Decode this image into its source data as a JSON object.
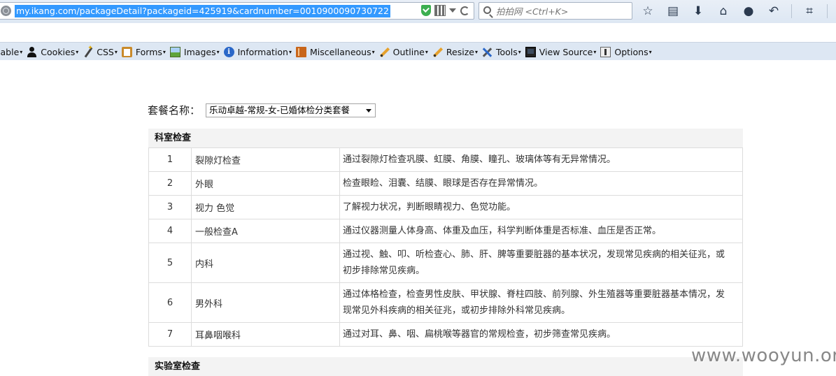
{
  "browser": {
    "url": "my.ikang.com/packageDetail?packageid=425919&cardnumber=0010900090730722",
    "search_placeholder": "拍拍网 <Ctrl+K>"
  },
  "devtoolbar": {
    "items": [
      {
        "label": "sable",
        "icon": "none"
      },
      {
        "label": "Cookies",
        "icon": "person-icon"
      },
      {
        "label": "CSS",
        "icon": "wand-icon"
      },
      {
        "label": "Forms",
        "icon": "clipboard-icon"
      },
      {
        "label": "Images",
        "icon": "image-icon"
      },
      {
        "label": "Information",
        "icon": "info-icon"
      },
      {
        "label": "Miscellaneous",
        "icon": "book-icon"
      },
      {
        "label": "Outline",
        "icon": "pencil-icon"
      },
      {
        "label": "Resize",
        "icon": "pencil-icon"
      },
      {
        "label": "Tools",
        "icon": "tools-icon"
      },
      {
        "label": "View Source",
        "icon": "screen-icon"
      },
      {
        "label": "Options",
        "icon": "options-icon"
      }
    ]
  },
  "page": {
    "package_label": "套餐名称：",
    "package_selected": "乐动卓越-常规-女-已婚体检分类套餐",
    "sections": [
      {
        "title": "科室检查",
        "rows": [
          {
            "num": "1",
            "name": "裂隙灯检查",
            "desc": "通过裂隙灯检查巩膜、虹膜、角膜、瞳孔、玻璃体等有无异常情况。"
          },
          {
            "num": "2",
            "name": "外眼",
            "desc": "检查眼睑、泪囊、结膜、眼球是否存在异常情况。"
          },
          {
            "num": "3",
            "name": "视力 色觉",
            "desc": "了解视力状况，判断眼睛视力、色觉功能。"
          },
          {
            "num": "4",
            "name": "一般检查A",
            "desc": "通过仪器测量人体身高、体重及血压，科学判断体重是否标准、血压是否正常。"
          },
          {
            "num": "5",
            "name": "内科",
            "desc": "通过视、触、叩、听检查心、肺、肝、脾等重要脏器的基本状况，发现常见疾病的相关征兆，或初步排除常见疾病。"
          },
          {
            "num": "6",
            "name": "男外科",
            "desc": "通过体格检查，检查男性皮肤、甲状腺、脊柱四肢、前列腺、外生殖器等重要脏器基本情况，发现常见外科疾病的相关征兆，或初步排除外科常见疾病。"
          },
          {
            "num": "7",
            "name": "耳鼻咽喉科",
            "desc": "通过对耳、鼻、咽、扁桃喉等器官的常规检查，初步筛查常见疾病。"
          }
        ]
      },
      {
        "title": "实验室检查"
      }
    ]
  },
  "watermark": "www.wooyun.org"
}
